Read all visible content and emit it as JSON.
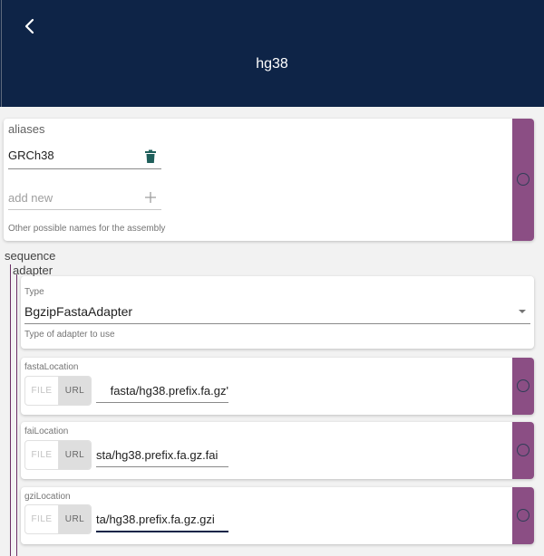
{
  "header": {
    "title": "hg38",
    "back_icon": "chevron-left-icon"
  },
  "aliases": {
    "label": "aliases",
    "value": "GRCh38",
    "delete_icon": "trash-icon",
    "add_placeholder": "add new",
    "add_icon": "plus-icon",
    "help": "Other possible names for the assembly"
  },
  "sequence": {
    "label": "sequence",
    "adapter_label": "adapter",
    "type_label": "Type",
    "type_value": "BgzipFastaAdapter",
    "type_help": "Type of adapter to use",
    "dropdown_icon": "caret-down-icon",
    "locations": [
      {
        "label": "fastaLocation",
        "file": "FILE",
        "url": "URL",
        "value": "'fasta/hg38.prefix.fa.gz"
      },
      {
        "label": "faiLocation",
        "file": "FILE",
        "url": "URL",
        "value": "sta/hg38.prefix.fa.gz.fai"
      },
      {
        "label": "gziLocation",
        "file": "FILE",
        "url": "URL",
        "value": "ta/hg38.prefix.fa.gz.gzi"
      }
    ]
  },
  "colors": {
    "header": "#0e2447",
    "accent": "#8b4e84",
    "trash": "#1f5f5b"
  }
}
